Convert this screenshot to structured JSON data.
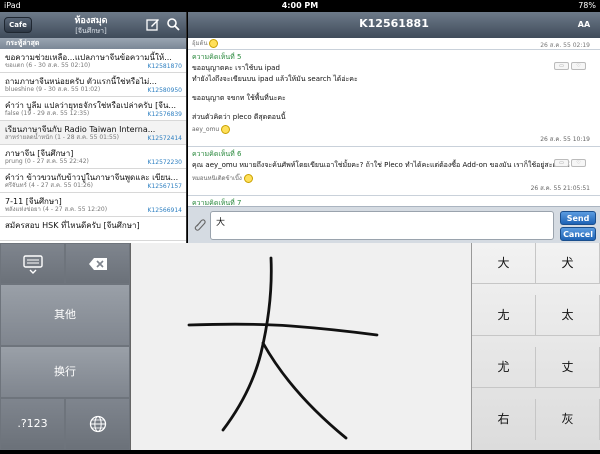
{
  "status": {
    "device": "iPad",
    "time": "4:00 PM",
    "battery": "78%"
  },
  "left": {
    "cafe_label": "Cafe",
    "title": "ห้องสมุด",
    "subtitle": "[จีนศึกษา]",
    "section": "กระทู้ล่าสุด",
    "threads": [
      {
        "title": "ขอความช่วยเหลือ...แปลภาษาจีนข้อความนี้ให้...",
        "meta": "ขอแตก (6 - 30 ส.ค. 55 02:10)",
        "id": "K12581870"
      },
      {
        "title": "ถามภาษาจีนหน่อยครับ ตัวแรกนี้ใช่หรือไม่...",
        "meta": "blueshine (9 - 30 ส.ค. 55 01:02)",
        "id": "K12580950"
      },
      {
        "title": "คำว่า บูลีม แปลว่ายุทธจักรใช่หรือเปล่าครับ [จีน...",
        "meta": "false (19 - 29 ส.ค. 55 12:35)",
        "id": "K12576839"
      },
      {
        "title": "เรียนภาษาจีนกับ Radio Taiwan Interna...",
        "meta": "สาหร่ายลดน้ำหนัก (1 - 28 ส.ค. 55 01:55)",
        "id": "K12572414"
      },
      {
        "title": "ภาษาจีน [จีนศึกษา]",
        "meta": "prung (0 - 27 ส.ค. 55 22:42)",
        "id": "K12572230"
      },
      {
        "title": "คำว่า ข้าวขวนกับข้าวปูในภาษาจีนพูดและ เขียน...",
        "meta": "ศรีจันทร์ (4 - 27 ส.ค. 55 01:26)",
        "id": "K12567157"
      },
      {
        "title": "7-11 [จีนศึกษา]",
        "meta": "พลังแห่งข่อยา (4 - 27 ส.ค. 55 12:20)",
        "id": "K12566914"
      },
      {
        "title": "สมัครสอบ HSK ที่ไหนดีครับ [จีนศึกษา]",
        "meta": "",
        "id": ""
      }
    ]
  },
  "right": {
    "title": "K12561881",
    "font_label": "AA",
    "top_user": "อุ้มต้น",
    "top_date": "26 ส.ค. 55 02:19",
    "messages": [
      {
        "header": "ความคิดเห็นที่ 5",
        "lines": [
          "ขออนุญาตคะ เราใช้บน ipad",
          "ทำยังไงถึงจะเขียนบน ipad แล้วให้มัน search ได้อ่ะคะ",
          "",
          "ขออนุญาต จขกท ใช้พื้นที่นะคะ",
          "",
          "ส่วนตัวคิดว่า pleco ดีสุดตอนนี้"
        ],
        "user": "aey_omu",
        "date": "26 ส.ค. 55 10:19"
      },
      {
        "header": "ความคิดเห็นที่ 6",
        "lines": [
          "คุณ aey_omu หมายถึงจะค้นศัพท์โดยเขียนเอาใช่มั้ยคะ? ถ้าใช่ Pleco ทำได้คะแต่ต้องซื้อ Add-on ของมัน เราก็ใช้อยู่สะดวกดี"
        ],
        "user": "หมอนหนิเติดข้าเบิ๊ง",
        "date": "26 ส.ค. 55 21:05:51"
      },
      {
        "header": "ความคิดเห็นที่ 7",
        "lines": [],
        "user": "",
        "date": ""
      }
    ],
    "compose_value": "大",
    "send_label": "Send",
    "cancel_label": "Cancel"
  },
  "keyboard": {
    "other_label": "其他",
    "newline_label": "换行",
    "numbers_label": ".?123",
    "candidates": [
      "大",
      "犬",
      "太",
      "尢",
      "丈",
      "尤",
      "右",
      "灰"
    ]
  },
  "icons": {
    "compose": "compose-icon",
    "search": "search-icon",
    "clip": "paperclip-icon",
    "hide_keyboard": "hide-keyboard-icon",
    "delete": "delete-icon",
    "globe": "globe-icon"
  }
}
